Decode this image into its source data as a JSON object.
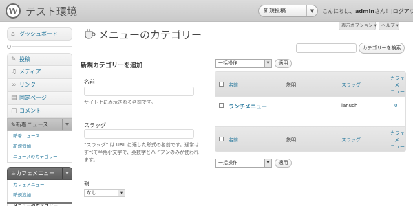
{
  "header": {
    "logo": "W",
    "site_title": "テスト環境",
    "favorite_action": "新規投稿",
    "greeting_prefix": "こんにちは、",
    "username": "admin",
    "greeting_suffix": "さん！",
    "separator": "|",
    "logout": "ログアウト"
  },
  "screen_meta": {
    "options": "表示オプション ▾",
    "help": "ヘルプ ▾"
  },
  "sidebar": {
    "dashboard": "ダッシュボード",
    "posts": "投稿",
    "media": "メディア",
    "links": "リンク",
    "pages": "固定ページ",
    "comments": "コメント",
    "news_menu": {
      "label": "新着ニュース",
      "items": [
        "新着ニュース",
        "新規追加",
        "ニュースのカテゴリー"
      ]
    },
    "cafe_menu": {
      "label": "カフェメニュー",
      "items": [
        "カフェメニュー",
        "新規追加",
        "メニューのカテゴリー"
      ]
    }
  },
  "page": {
    "title": "メニューのカテゴリー",
    "search_button": "カテゴリーを検索"
  },
  "form": {
    "heading": "新規カテゴリーを追加",
    "name_label": "名前",
    "name_desc": "サイト上に表示される名前です。",
    "slug_label": "スラッグ",
    "slug_desc": "“スラッグ” は URL に適した形式の名前です。通常はすべて半角小文字で、英数字とハイフンのみが使われます。",
    "parent_label": "親",
    "parent_value": "なし"
  },
  "bulk": {
    "top_select": "一括操作",
    "top_apply": "適用",
    "bottom_select": "一括操作",
    "bottom_apply": "適用"
  },
  "table": {
    "columns": {
      "name": "名前",
      "description": "説明",
      "slug": "スラッグ",
      "count_line1": "カフェ",
      "count_line2": "メ",
      "count_line3": "ニュー"
    },
    "rows": [
      {
        "name": "ランチメニュー",
        "description": "",
        "slug": "lanuch",
        "count": "0"
      }
    ]
  },
  "colors": {
    "link": "#21759b",
    "header_bg": "#d4d4d4",
    "active_menu": "#6a6a6a"
  }
}
